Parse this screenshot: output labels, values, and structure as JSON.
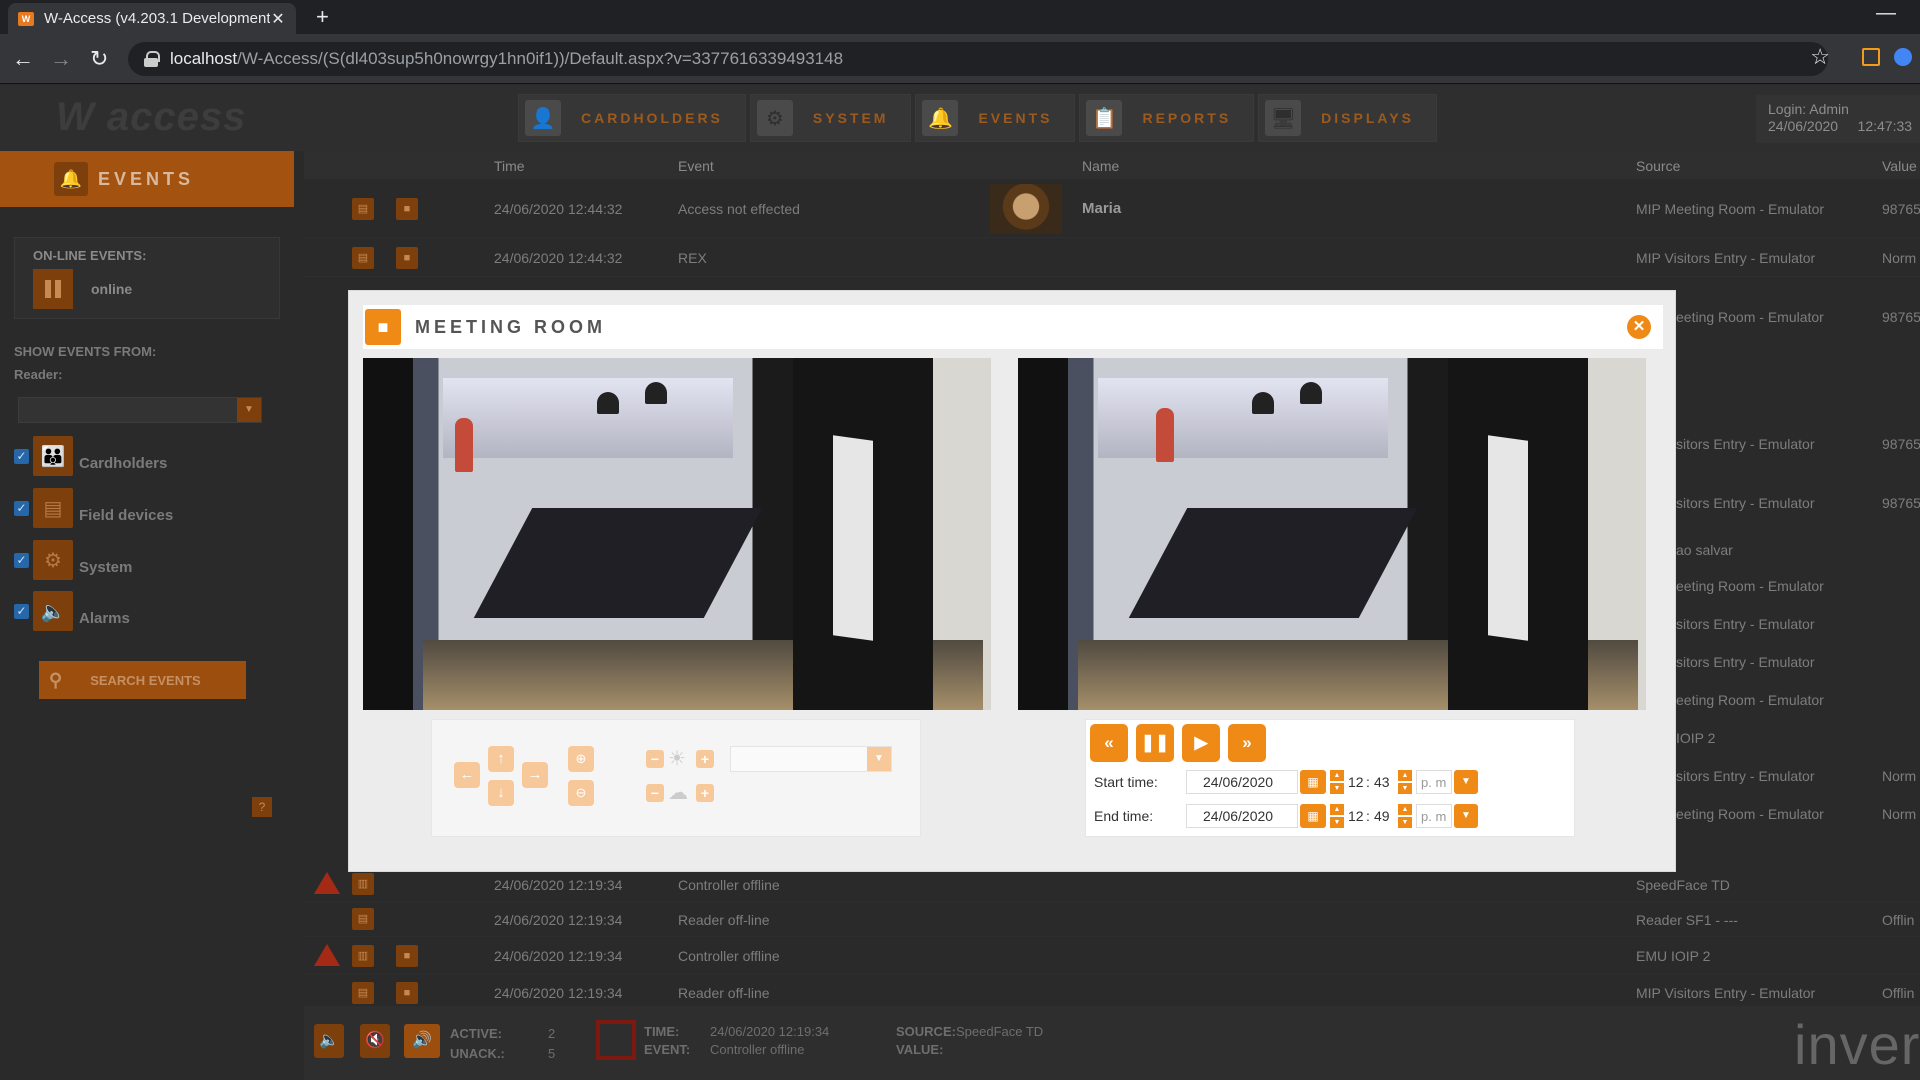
{
  "browser": {
    "tab_title": "W-Access (v4.203.1 Development",
    "new_tab": "+",
    "url_host": "localhost",
    "url_path": "/W-Access/(S(dl403sup5h0nowrgy1hn0if1))/Default.aspx?v=3377616339493148"
  },
  "header": {
    "logo": "W access",
    "nav": [
      "CARDHOLDERS",
      "SYSTEM",
      "EVENTS",
      "REPORTS",
      "DISPLAYS"
    ],
    "login_label": "Login: Admin",
    "login_date": "24/06/2020",
    "login_time": "12:47:33"
  },
  "sidebar": {
    "title": "EVENTS",
    "online_caption": "ON-LINE EVENTS:",
    "online_state": "online",
    "show_from": "SHOW EVENTS FROM:",
    "reader_label": "Reader:",
    "filters": [
      "Cardholders",
      "Field devices",
      "System",
      "Alarms"
    ],
    "search_button": "SEARCH EVENTS",
    "help": "?"
  },
  "table": {
    "headers": {
      "time": "Time",
      "event": "Event",
      "name": "Name",
      "source": "Source",
      "value": "Value"
    },
    "top_rows": [
      {
        "time": "24/06/2020 12:44:32",
        "event": "Access not effected",
        "name": "Maria",
        "source": "MIP Meeting Room - Emulator",
        "value": "98765"
      },
      {
        "time": "24/06/2020 12:44:32",
        "event": "REX",
        "name": "",
        "source": "MIP Visitors Entry - Emulator",
        "value": "Norm"
      }
    ],
    "partial_sources": [
      "eeting Room - Emulator",
      "sitors Entry - Emulator",
      "sitors Entry - Emulator",
      "ao salvar",
      "eeting Room - Emulator",
      "sitors Entry - Emulator",
      "sitors Entry - Emulator",
      "eeting Room - Emulator",
      "IOIP 2",
      "sitors Entry - Emulator",
      "eeting Room - Emulator"
    ],
    "partial_values": [
      "98765",
      "98765",
      "98765",
      "Norm",
      "Norm"
    ],
    "bottom_rows": [
      {
        "time": "24/06/2020 12:19:34",
        "event": "Controller offline",
        "source": "SpeedFace TD",
        "value": ""
      },
      {
        "time": "24/06/2020 12:19:34",
        "event": "Reader off-line",
        "source": "Reader SF1 - ---",
        "value": "Offlin"
      },
      {
        "time": "24/06/2020 12:19:34",
        "event": "Controller offline",
        "source": "EMU IOIP 2",
        "value": ""
      },
      {
        "time": "24/06/2020 12:19:34",
        "event": "Reader off-line",
        "source": "MIP Visitors Entry - Emulator",
        "value": "Offlin"
      }
    ]
  },
  "modal": {
    "title": "MEETING ROOM",
    "start_label": "Start time:",
    "start_date": "24/06/2020",
    "start_hour": "12",
    "start_min": "43",
    "start_ampm": "p. m",
    "end_label": "End time:",
    "end_date": "24/06/2020",
    "end_hour": "12",
    "end_min": "49",
    "end_ampm": "p. m",
    "colon": ":"
  },
  "status": {
    "active_label": "ACTIVE:",
    "active_value": "2",
    "unack_label": "UNACK.:",
    "unack_value": "5",
    "time_label": "TIME:",
    "time_value": "24/06/2020 12:19:34",
    "event_label": "EVENT:",
    "event_value": "Controller offline",
    "source_label": "SOURCE:",
    "source_value": "SpeedFace TD",
    "value_label": "VALUE:",
    "brand": "inver"
  },
  "colors": {
    "accent": "#f08a16",
    "dim_accent": "#7d3f0b",
    "alarm": "#a52a16"
  }
}
